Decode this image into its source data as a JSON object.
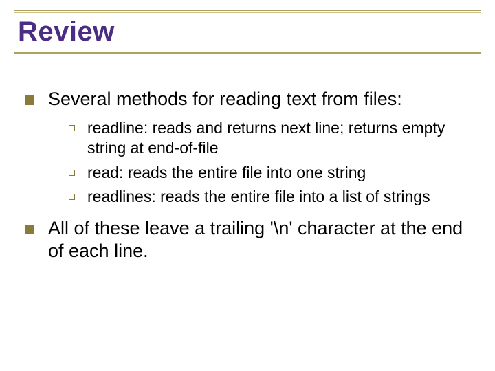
{
  "title": "Review",
  "bullets": [
    {
      "text": "Several methods for reading text from files:",
      "sub": [
        "readline: reads and returns next line; returns empty string at end-of-file",
        "read: reads the entire file into one string",
        "readlines: reads the entire file into a list of strings"
      ]
    },
    {
      "text": "All of these leave a trailing '\\n' character at the end of each line.",
      "sub": []
    }
  ]
}
